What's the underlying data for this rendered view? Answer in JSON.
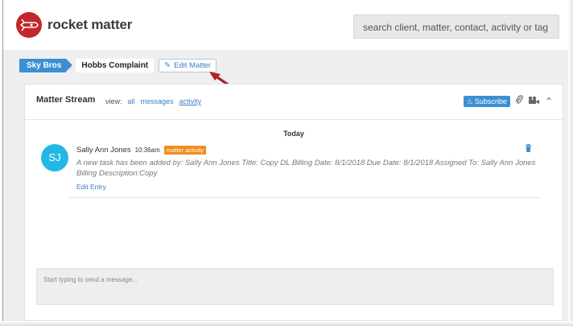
{
  "app": {
    "logo_text": "rocket matter"
  },
  "search": {
    "placeholder": "search client, matter, contact, activity or tag"
  },
  "breadcrumb": {
    "client": "Sky Bros",
    "matter": "Hobbs Complaint",
    "edit_matter_label": "Edit Matter"
  },
  "stream": {
    "title": "Matter Stream",
    "view_label": "view:",
    "view_options": [
      "all",
      "messages",
      "activity"
    ],
    "active_view": "activity",
    "subscribe_label": "Subscribe",
    "day_label": "Today",
    "entry": {
      "avatar_initials": "SJ",
      "author": "Sally Ann Jones",
      "time": "10:36am",
      "badge": "matter activity",
      "text": "A new task has been added by: Sally Ann Jones Title: Copy DL Billing Date: 8/1/2018 Due Date: 8/1/2018 Assigned To: Sally Ann Jones Billing Description:Copy",
      "edit_label": "Edit Entry"
    },
    "message_placeholder": "Start typing to send a message..."
  },
  "colors": {
    "brand_red": "#c0282d",
    "accent_blue": "#3d8fd4",
    "badge_orange": "#f08c1f",
    "avatar_cyan": "#22b8e6",
    "annotation_arrow": "#b22222"
  },
  "icons": [
    "rocket-logo-icon",
    "pencil-icon",
    "bell-icon",
    "paperclip-icon",
    "video-icon",
    "chevron-up-icon",
    "trash-icon"
  ]
}
